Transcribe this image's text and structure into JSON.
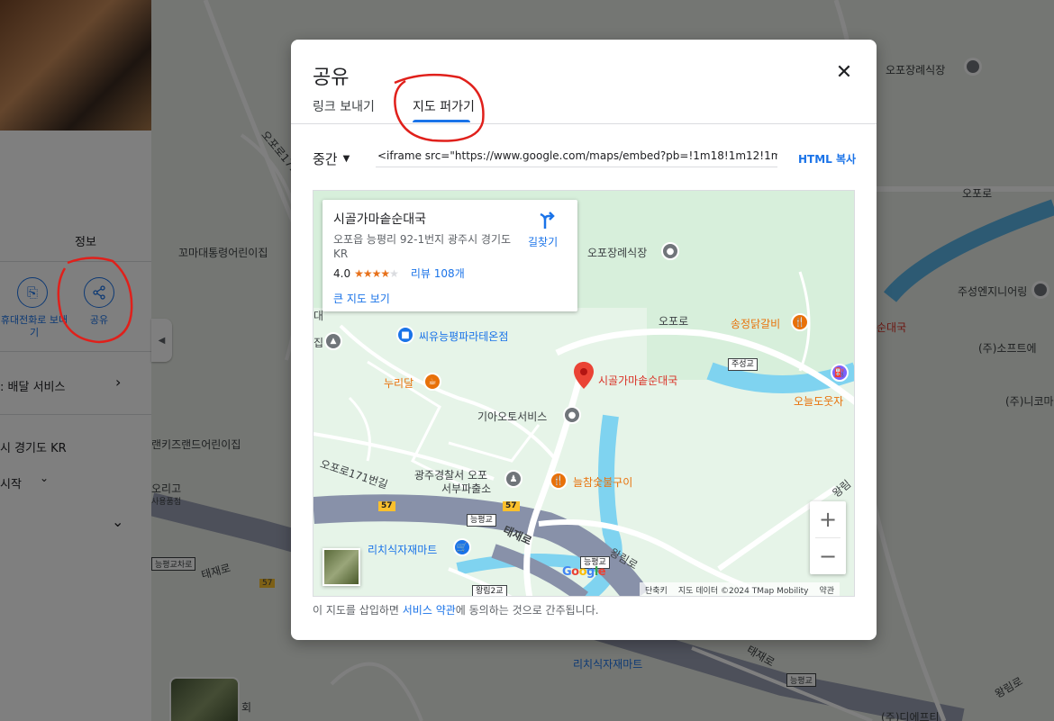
{
  "background_map": {
    "labels": {
      "place_top_right": "오포장례식장",
      "road_1": "오포로",
      "road_171": "오포로171",
      "kindergarten": "꼬마대통령어린이집",
      "engineering": "주성엔지니어링",
      "restaurant_red": "순대국",
      "software": "(주)소프트에",
      "nikoma": "(주)니코마",
      "kids_land": "랜키즈랜드어린이집",
      "mart_bottom": "리치식자재마트",
      "road_taejae": "태재로",
      "road_wangrim": "왕림로",
      "bridge_bottom": "능평교",
      "neungpyeong_gyo_road": "능평교차로",
      "route_57": "57",
      "company_bottom": "(주)디에프티",
      "hoe": "회"
    }
  },
  "left_panel": {
    "info_tab": "정보",
    "action_phone": "휴대전화로 보내기",
    "action_share": "공유",
    "delivery": "배달 서비스",
    "address_partial": "시 경기도 KR",
    "hours_partial": "시작",
    "poi_partial": "오리고",
    "poi_partial_2": "사용품점"
  },
  "dialog": {
    "title": "공유",
    "close_icon": "close-icon",
    "tabs": [
      {
        "label": "링크 보내기",
        "active": false
      },
      {
        "label": "지도 퍼가기",
        "active": true
      }
    ],
    "size_select": "중간",
    "embed_code": "<iframe src=\"https://www.google.com/maps/embed?pb=!1m18!1m12!1m3!1",
    "copy_html_label": "HTML 복사",
    "footer_text_before": "이 지도를 삽입하면 ",
    "footer_link": "서비스 약관",
    "footer_text_after": "에 동의하는 것으로 간주됩니다."
  },
  "embedded_map": {
    "info_card": {
      "place_name": "시골가마솥순대국",
      "address": "오포읍 능평리 92-1번지 광주시 경기도 KR",
      "rating": "4.0",
      "stars_filled": 4,
      "stars_total": 5,
      "reviews": "리뷰 108개",
      "bigger_map": "큰 지도 보기",
      "directions": "길찾기"
    },
    "labels": {
      "funeral_hall": "오포장례식장",
      "ssiyu": "씨유능평파라테온점",
      "nurildal": "누리달",
      "kia_service": "기아오토서비스",
      "police_1": "광주경찰서 오포",
      "police_2": "서부파출소",
      "neulcham": "늘참숯불구이",
      "songjeong": "송정닭갈비",
      "oneul_auto": "오늘도웃자",
      "mart": "리치식자재마트",
      "road_opo": "오포로",
      "road_opo171": "오포로171번길",
      "road_taejae": "태재로",
      "road_wangrim": "왕림로",
      "road_wangrim_top": "왕림",
      "bridge_juseong": "주성교",
      "bridge_neungpyeong": "능평교",
      "bridge_neungpyeong_2": "능평교",
      "bridge_wangrim2": "왕림2교",
      "route_57a": "57",
      "route_57b": "57",
      "dae": "대",
      "jip": "집",
      "selected_place": "시골가마솥순대국"
    },
    "google_logo": "Google",
    "footer": {
      "shortcuts": "단축키",
      "map_data": "지도 데이터 ©2024 TMap Mobility",
      "terms": "약관"
    },
    "zoom_in": "+",
    "zoom_out": "−"
  },
  "colors": {
    "accent": "#1a73e8",
    "annotation": "#e0201b",
    "map_green": "#e4f3e6",
    "water": "#4fc3f7"
  }
}
